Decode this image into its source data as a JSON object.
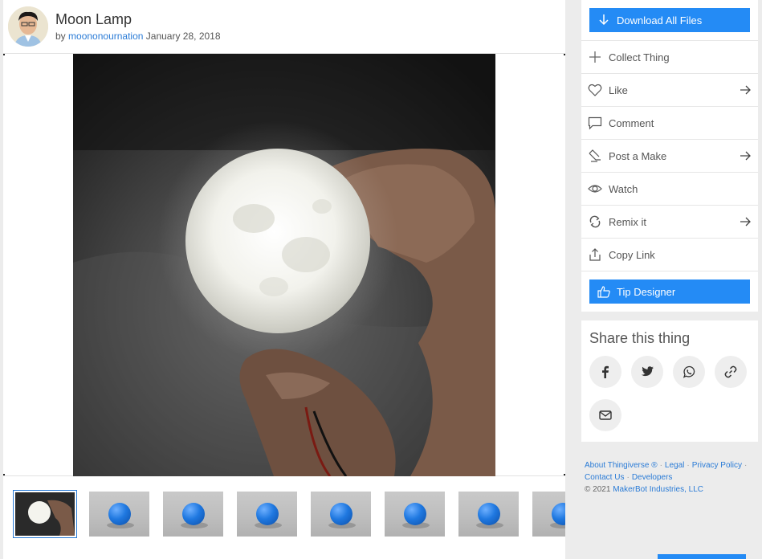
{
  "thing": {
    "title": "Moon Lamp",
    "by_prefix": "by",
    "author": "moononournation",
    "date": "January 28, 2018"
  },
  "sidebar": {
    "download_label": "Download All Files",
    "actions": [
      {
        "label": "Collect Thing",
        "icon": "plus-icon",
        "has_arrow": false
      },
      {
        "label": "Like",
        "icon": "heart-icon",
        "has_arrow": true
      },
      {
        "label": "Comment",
        "icon": "comment-icon",
        "has_arrow": false
      },
      {
        "label": "Post a Make",
        "icon": "make-icon",
        "has_arrow": true
      },
      {
        "label": "Watch",
        "icon": "eye-icon",
        "has_arrow": false
      },
      {
        "label": "Remix it",
        "icon": "remix-icon",
        "has_arrow": true
      },
      {
        "label": "Copy Link",
        "icon": "share-upload-icon",
        "has_arrow": false
      }
    ],
    "tip_label": "Tip Designer"
  },
  "share": {
    "title": "Share this thing",
    "buttons": [
      "facebook-icon",
      "twitter-icon",
      "whatsapp-icon",
      "link-icon",
      "mail-icon"
    ]
  },
  "footer": {
    "about": "About Thingiverse ®",
    "legal": "Legal",
    "privacy": "Privacy Policy",
    "contact": "Contact Us",
    "developers": "Developers",
    "copyright_prefix": "©  2021",
    "company": "MakerBot Industries, LLC"
  },
  "colors": {
    "accent": "#248bf5",
    "link": "#2a7bd6"
  }
}
